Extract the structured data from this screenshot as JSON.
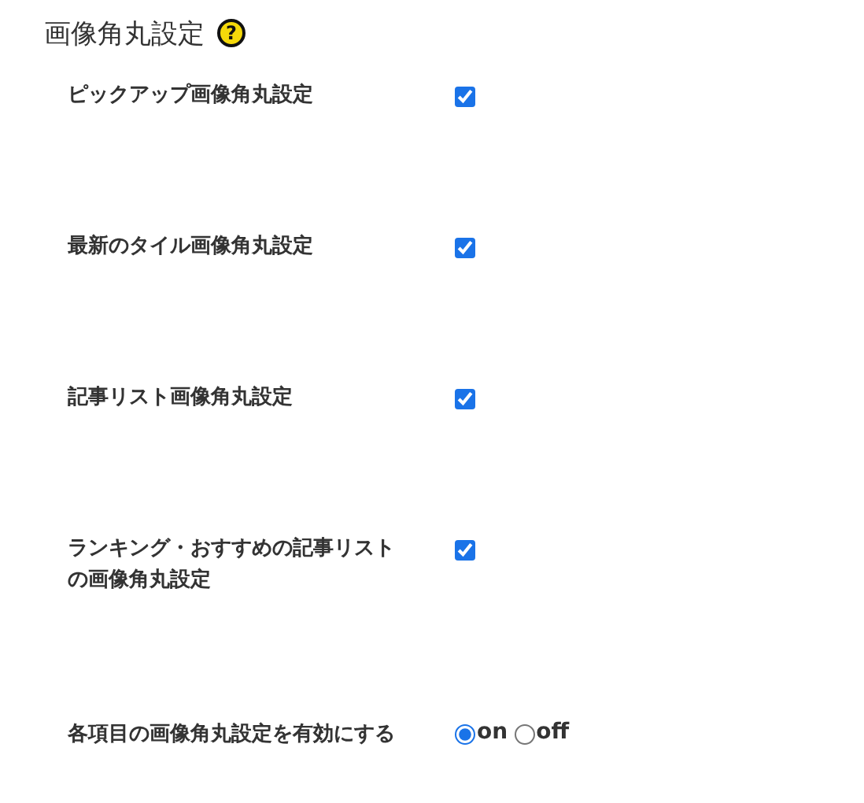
{
  "heading": {
    "title": "画像角丸設定",
    "help": "?"
  },
  "settings": [
    {
      "kind": "checkbox",
      "label": "ピックアップ画像角丸設定",
      "checked": true
    },
    {
      "kind": "checkbox",
      "label": "最新のタイル画像角丸設定",
      "checked": true
    },
    {
      "kind": "checkbox",
      "label": "記事リスト画像角丸設定",
      "checked": true
    },
    {
      "kind": "checkbox",
      "label": "ランキング・おすすめの記事リストの画像角丸設定",
      "checked": true
    },
    {
      "kind": "radio",
      "label": "各項目の画像角丸設定を有効にする",
      "options": [
        {
          "label": "on",
          "selected": true
        },
        {
          "label": "off",
          "selected": false
        }
      ]
    }
  ]
}
